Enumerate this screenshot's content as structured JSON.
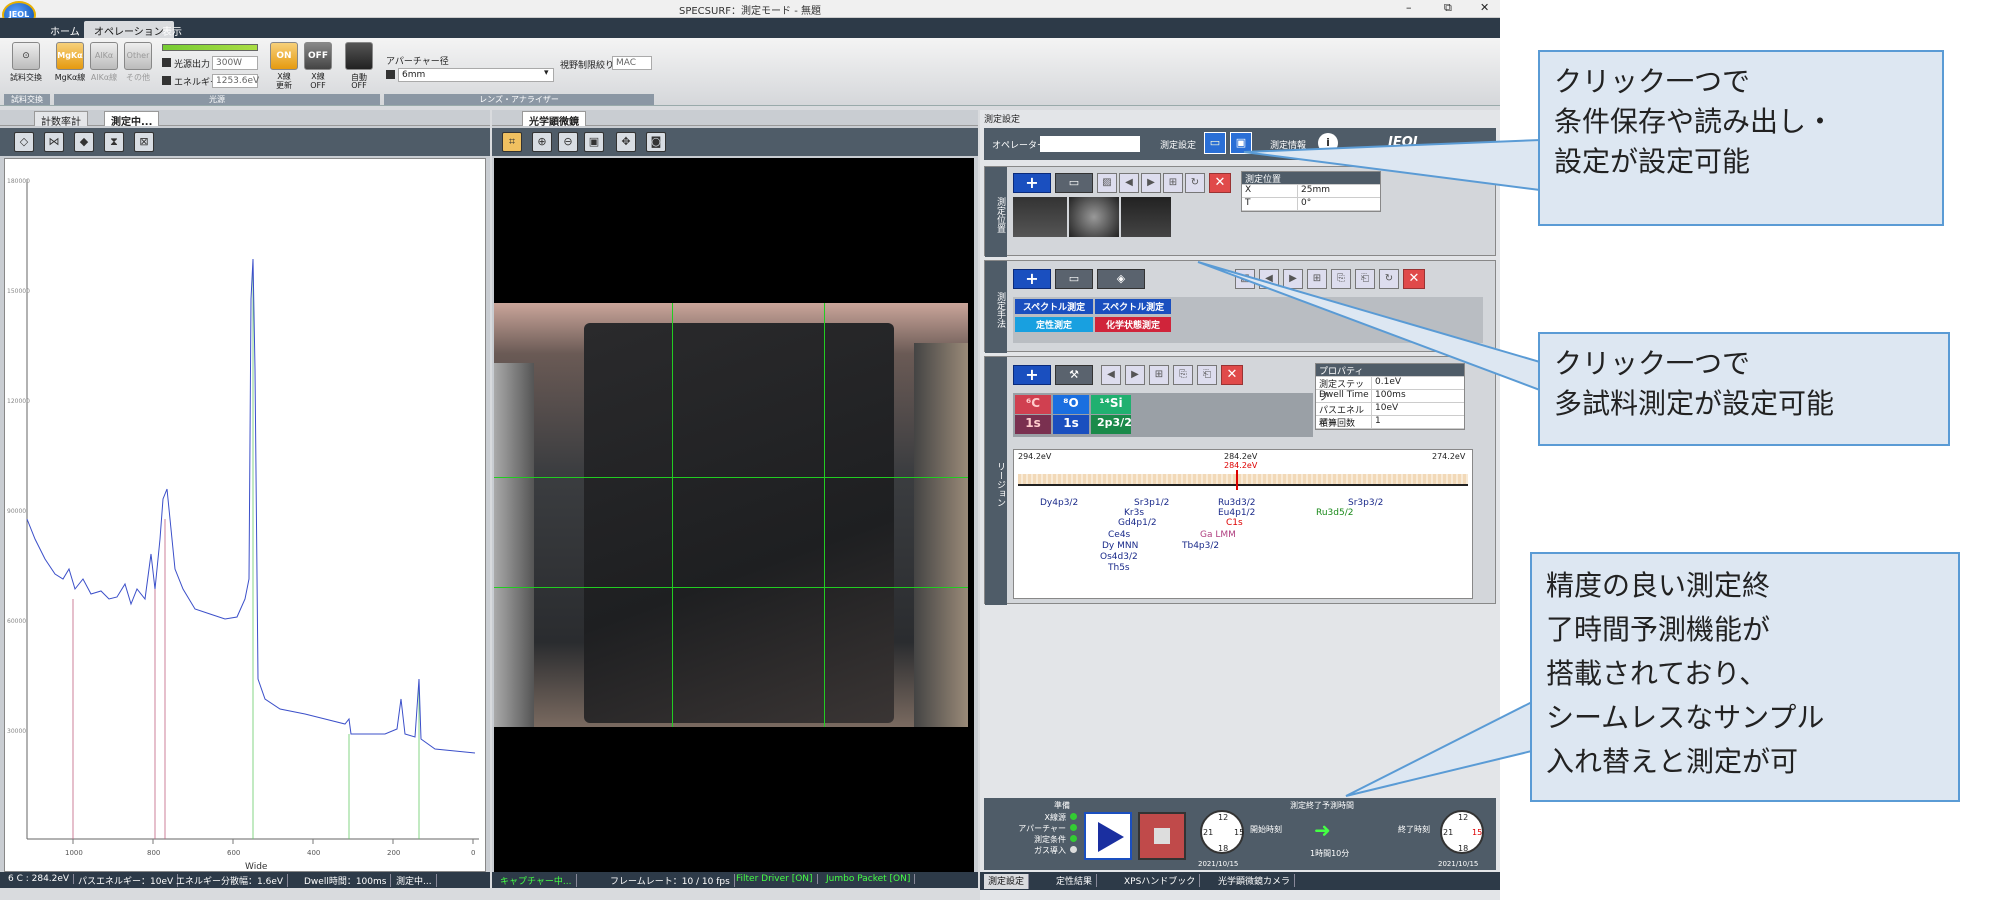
{
  "window": {
    "title": "SPECSURF：測定モード - 無題",
    "minimize": "–",
    "restore": "⧉",
    "close": "✕"
  },
  "logo": "JEOL",
  "menu_tabs": [
    "ホーム",
    "オペレーション",
    "表示"
  ],
  "ribbon": {
    "sample_exchange": {
      "button": "試料交換",
      "group": "試料交換"
    },
    "xray": {
      "mgka": "MgKα",
      "alka": "AlKα",
      "other": "Other",
      "mgka_label": "MgKα線",
      "alka_label": "AlKα線",
      "other_label": "その他",
      "power_label": "光源出力",
      "power_value": "300W",
      "energy_label": "エネルギー",
      "energy_value": "1253.6eV",
      "on": "ON",
      "off": "OFF",
      "xray_update": "X線\n更新",
      "xray_off": "X線\nOFF",
      "auto": "自動",
      "auto_off": "OFF",
      "group": "光源"
    },
    "lens": {
      "aperture_label": "アパーチャー径",
      "aperture_value": "6mm",
      "view_label": "視野制限絞り",
      "view_value": "MAC",
      "group": "レンズ・アナライザー"
    }
  },
  "left_panel": {
    "tabs": [
      "計数率計",
      "測定中..."
    ],
    "xlabel": "Wide",
    "status": [
      "6 C : 284.2eV",
      "パスエネルギー：10eV",
      "エネルギー分散幅：1.6eV",
      "Dwell時間：100ms",
      "測定中..."
    ]
  },
  "center_panel": {
    "tab": "光学顕微鏡",
    "status": [
      "キャプチャー中...",
      "フレームレート：10 / 10 fps",
      "Filter Driver [ON]",
      "Jumbo Packet [ON]"
    ]
  },
  "right_panel": {
    "header": "測定設定",
    "operator_label": "オペレーター",
    "settings_label": "測定設定",
    "info_label": "測定情報",
    "brand": "JEOL",
    "pos_section": {
      "side": "測定位置",
      "table_title": "測定位置",
      "rows": [
        [
          "X",
          "25mm"
        ],
        [
          "T",
          "0°"
        ]
      ]
    },
    "method_section": {
      "side": "測定手法",
      "cells": [
        [
          "スペクトル測定",
          "スペクトル測定"
        ],
        [
          "定性測定",
          "化学状態測定"
        ]
      ]
    },
    "region_section": {
      "side": "リージョン",
      "elements": [
        {
          "sym": "⁶C",
          "sub": "1s"
        },
        {
          "sym": "⁸O",
          "sub": "1s"
        },
        {
          "sym": "¹⁴Si",
          "sub": "2p3/2"
        }
      ],
      "props_title": "プロパティ",
      "props": [
        [
          "測定ステップ",
          "0.1eV"
        ],
        [
          "Dwell Time",
          "100ms"
        ],
        [
          "パスエネルギー",
          "10eV"
        ],
        [
          "積算回数",
          "1"
        ]
      ],
      "axis": {
        "left": "294.2eV",
        "mid": "284.2eV",
        "mid_red": "284.2eV",
        "right": "274.2eV"
      },
      "peaks": [
        "Dy4p3/2",
        "Sr3p1/2",
        "Kr3s",
        "Gd4p1/2",
        "Ce4s",
        "Dy MNN",
        "Os4d3/2",
        "Th5s",
        "Ru3d3/2",
        "Eu4p1/2",
        "C1s",
        "Ga LMM",
        "Tb4p3/2",
        "Sr3p3/2",
        "Ru3d5/2"
      ]
    },
    "bottom": {
      "prep_title": "準備",
      "prep_items": [
        "X線源",
        "アパーチャー",
        "測定条件",
        "ガス導入"
      ],
      "time_title": "測定終了予測時間",
      "start_label": "開始時刻",
      "end_label": "終了時刻",
      "duration": "1時間10分",
      "start_date": "2021/10/15",
      "end_date": "2021/10/15",
      "clock_nums": [
        "12",
        "15",
        "18",
        "21"
      ]
    },
    "tabs": [
      "測定設定",
      "定性結果",
      "XPSハンドブック",
      "光学顕微鏡カメラ"
    ]
  },
  "callouts": [
    "クリック一つで\n条件保存や読み出し・\n設定が設定可能",
    "クリック一つで\n多試料測定が設定可能",
    "精度の良い測定終\n了時間予測機能が\n搭載されており、\nシームレスなサンプル\n入れ替えと測定が可"
  ],
  "colors": {
    "accent_blue": "#1a4fbf",
    "callout_border": "#5a9bd5",
    "callout_bg": "#dde7f2",
    "cursor_green": "#22cc22"
  }
}
